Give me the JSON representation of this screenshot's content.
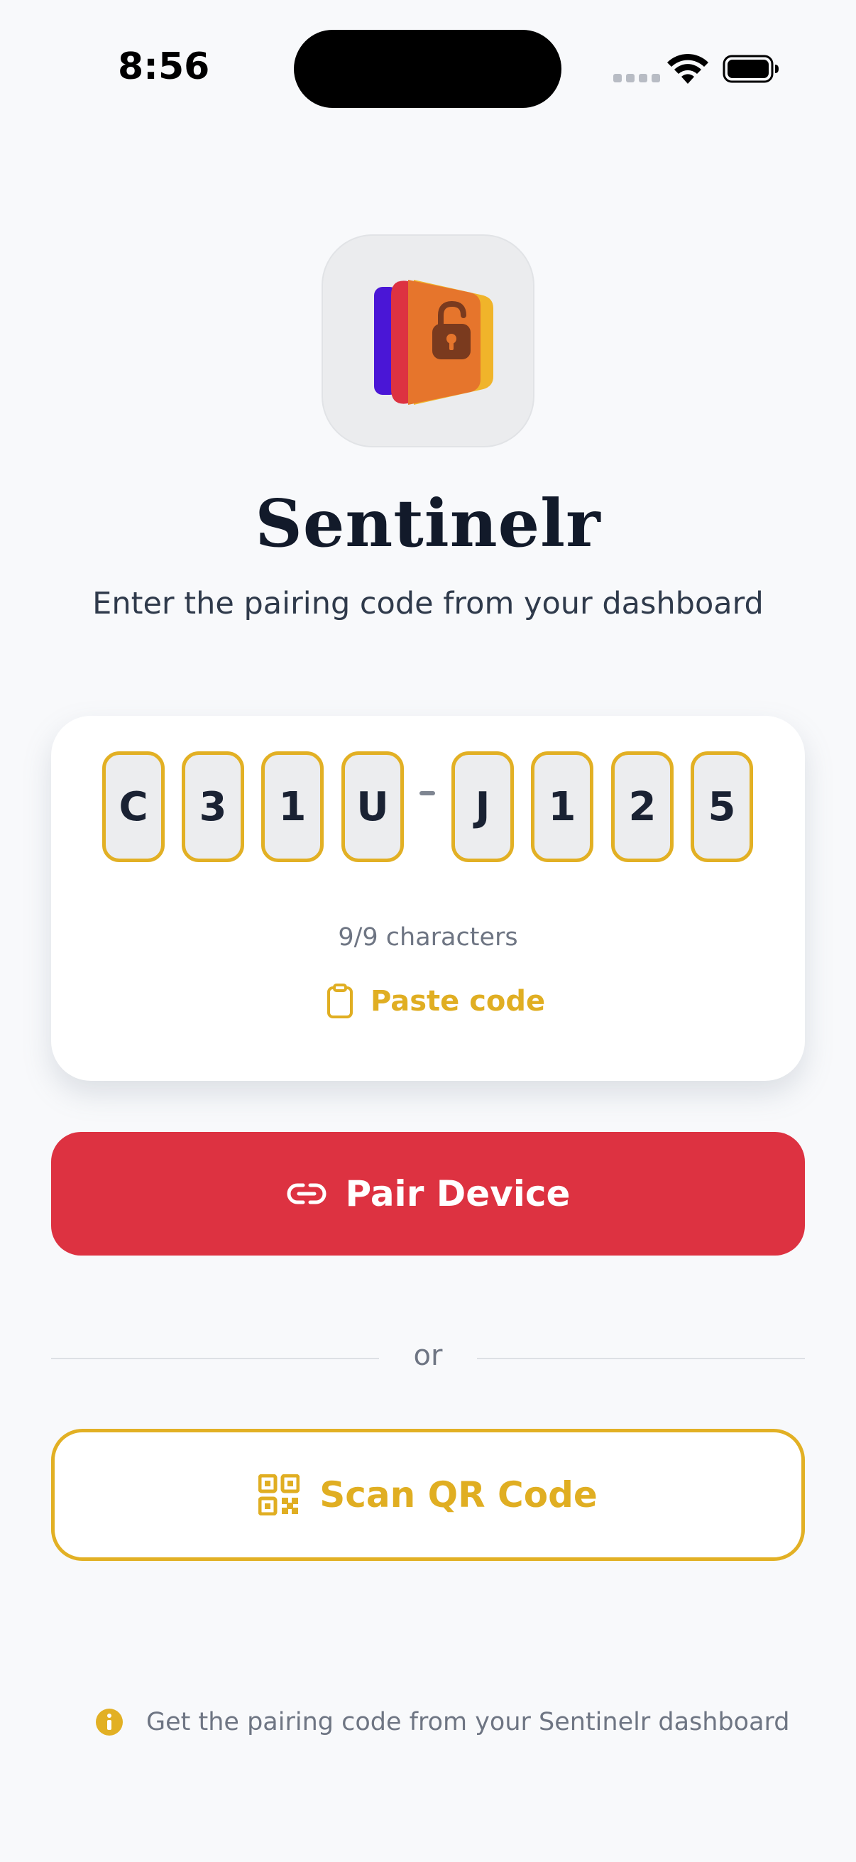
{
  "status_bar": {
    "time": "8:56"
  },
  "app": {
    "name": "Sentinelr",
    "subtitle": "Enter the pairing code from your dashboard"
  },
  "code": {
    "characters": [
      "C",
      "3",
      "1",
      "U",
      "J",
      "1",
      "2",
      "5"
    ],
    "count_text": "9/9 characters",
    "paste_label": "Paste code"
  },
  "pair_button": {
    "label": "Pair Device"
  },
  "divider": {
    "label": "or"
  },
  "scan_button": {
    "label": "Scan QR Code"
  },
  "hint": {
    "text": "Get the pairing code from your Sentinelr dashboard"
  },
  "icons": {
    "app": "padlock-folder-icon",
    "paste": "clipboard-icon",
    "pair": "link-icon",
    "scan": "qr-code-icon",
    "hint": "info-icon"
  },
  "colors": {
    "background": "#F8F9FB",
    "accent_yellow": "#E2B024",
    "primary_red": "#DD3241",
    "text_dark": "#121A2A",
    "text_muted": "#6E7583"
  }
}
